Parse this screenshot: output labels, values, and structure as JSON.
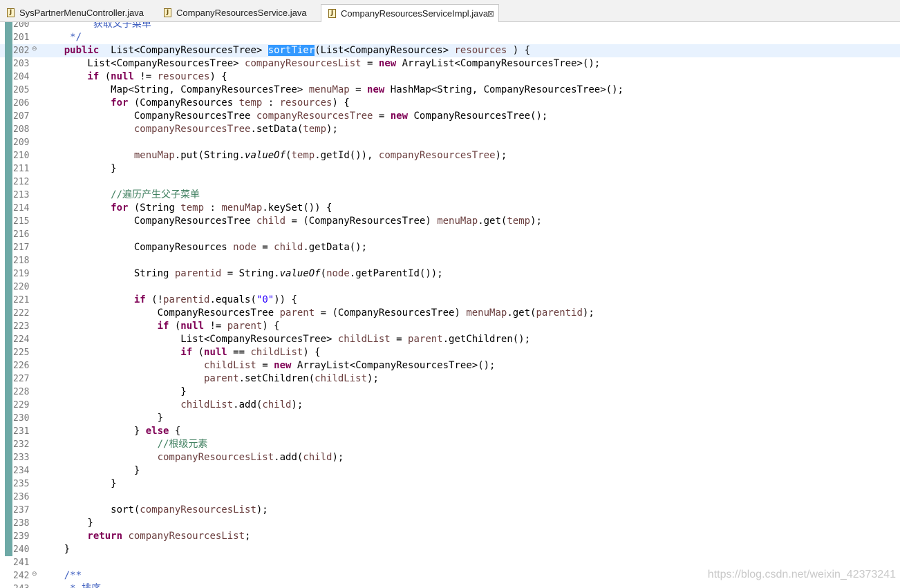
{
  "tabs": [
    {
      "label": "SysPartnerMenuController.java",
      "active": false
    },
    {
      "label": "CompanyResourcesService.java",
      "active": false
    },
    {
      "label": "CompanyResourcesServiceImpl.java",
      "active": true,
      "close": "⊠"
    }
  ],
  "editor": {
    "selected_token": "sortTier",
    "colors": {
      "keyword": "#7f0055",
      "field": "#6a3e3e",
      "comment": "#3f7f5f",
      "javadoc": "#3f5fbf",
      "string": "#2a00ff",
      "selection": "#3399ff"
    },
    "lines": [
      {
        "n": "200",
        "tokens": [
          [
            "jd",
            "         获取父子菜单"
          ]
        ],
        "bar": true
      },
      {
        "n": "201",
        "tokens": [
          [
            "jd",
            "     */"
          ]
        ],
        "bar": true
      },
      {
        "n": "202",
        "fold": true,
        "cur": true,
        "bar": true,
        "tokens": [
          [
            "kw",
            "    public"
          ],
          [
            "",
            "  List<CompanyResourcesTree> "
          ],
          [
            "hl",
            "sortTier"
          ],
          [
            "",
            "(List<CompanyResources> "
          ],
          [
            "fld",
            "resources"
          ],
          [
            "",
            " ) {"
          ]
        ]
      },
      {
        "n": "203",
        "bar": true,
        "tokens": [
          [
            "",
            "        List<CompanyResourcesTree> "
          ],
          [
            "fld",
            "companyResourcesList"
          ],
          [
            "",
            " = "
          ],
          [
            "kw",
            "new"
          ],
          [
            "",
            " ArrayList<CompanyResourcesTree>();"
          ]
        ]
      },
      {
        "n": "204",
        "bar": true,
        "tokens": [
          [
            "kw",
            "        if"
          ],
          [
            "",
            " ("
          ],
          [
            "kw",
            "null"
          ],
          [
            "",
            " != "
          ],
          [
            "fld",
            "resources"
          ],
          [
            "",
            ") {"
          ]
        ]
      },
      {
        "n": "205",
        "bar": true,
        "tokens": [
          [
            "",
            "            Map<String, CompanyResourcesTree> "
          ],
          [
            "fld",
            "menuMap"
          ],
          [
            "",
            " = "
          ],
          [
            "kw",
            "new"
          ],
          [
            "",
            " HashMap<String, CompanyResourcesTree>();"
          ]
        ]
      },
      {
        "n": "206",
        "bar": true,
        "tokens": [
          [
            "kw",
            "            for"
          ],
          [
            "",
            " (CompanyResources "
          ],
          [
            "fld",
            "temp"
          ],
          [
            "",
            " : "
          ],
          [
            "fld",
            "resources"
          ],
          [
            "",
            ") {"
          ]
        ]
      },
      {
        "n": "207",
        "bar": true,
        "tokens": [
          [
            "",
            "                CompanyResourcesTree "
          ],
          [
            "fld",
            "companyResourcesTree"
          ],
          [
            "",
            " = "
          ],
          [
            "kw",
            "new"
          ],
          [
            "",
            " CompanyResourcesTree();"
          ]
        ]
      },
      {
        "n": "208",
        "bar": true,
        "tokens": [
          [
            "fld",
            "                companyResourcesTree"
          ],
          [
            "",
            ".setData("
          ],
          [
            "fld",
            "temp"
          ],
          [
            "",
            ");"
          ]
        ]
      },
      {
        "n": "209",
        "bar": true,
        "tokens": []
      },
      {
        "n": "210",
        "bar": true,
        "tokens": [
          [
            "fld",
            "                menuMap"
          ],
          [
            "",
            ".put(String."
          ],
          [
            "it",
            "valueOf"
          ],
          [
            "",
            "("
          ],
          [
            "fld",
            "temp"
          ],
          [
            "",
            ".getId()), "
          ],
          [
            "fld",
            "companyResourcesTree"
          ],
          [
            "",
            ");"
          ]
        ]
      },
      {
        "n": "211",
        "bar": true,
        "tokens": [
          [
            "",
            "            }"
          ]
        ]
      },
      {
        "n": "212",
        "bar": true,
        "tokens": []
      },
      {
        "n": "213",
        "bar": true,
        "tokens": [
          [
            "cm",
            "            //遍历产生父子菜单"
          ]
        ]
      },
      {
        "n": "214",
        "bar": true,
        "tokens": [
          [
            "kw",
            "            for"
          ],
          [
            "",
            " (String "
          ],
          [
            "fld",
            "temp"
          ],
          [
            "",
            " : "
          ],
          [
            "fld",
            "menuMap"
          ],
          [
            "",
            ".keySet()) {"
          ]
        ]
      },
      {
        "n": "215",
        "bar": true,
        "tokens": [
          [
            "",
            "                CompanyResourcesTree "
          ],
          [
            "fld",
            "child"
          ],
          [
            "",
            " = (CompanyResourcesTree) "
          ],
          [
            "fld",
            "menuMap"
          ],
          [
            "",
            ".get("
          ],
          [
            "fld",
            "temp"
          ],
          [
            "",
            ");"
          ]
        ]
      },
      {
        "n": "216",
        "bar": true,
        "tokens": []
      },
      {
        "n": "217",
        "bar": true,
        "tokens": [
          [
            "",
            "                CompanyResources "
          ],
          [
            "fld",
            "node"
          ],
          [
            "",
            " = "
          ],
          [
            "fld",
            "child"
          ],
          [
            "",
            ".getData();"
          ]
        ]
      },
      {
        "n": "218",
        "bar": true,
        "tokens": []
      },
      {
        "n": "219",
        "bar": true,
        "tokens": [
          [
            "",
            "                String "
          ],
          [
            "fld",
            "parentid"
          ],
          [
            "",
            " = String."
          ],
          [
            "it",
            "valueOf"
          ],
          [
            "",
            "("
          ],
          [
            "fld",
            "node"
          ],
          [
            "",
            ".getParentId());"
          ]
        ]
      },
      {
        "n": "220",
        "bar": true,
        "tokens": []
      },
      {
        "n": "221",
        "bar": true,
        "tokens": [
          [
            "kw",
            "                if"
          ],
          [
            "",
            " (!"
          ],
          [
            "fld",
            "parentid"
          ],
          [
            "",
            ".equals("
          ],
          [
            "str",
            "\"0\""
          ],
          [
            "",
            ")) {"
          ]
        ]
      },
      {
        "n": "222",
        "bar": true,
        "tokens": [
          [
            "",
            "                    CompanyResourcesTree "
          ],
          [
            "fld",
            "parent"
          ],
          [
            "",
            " = (CompanyResourcesTree) "
          ],
          [
            "fld",
            "menuMap"
          ],
          [
            "",
            ".get("
          ],
          [
            "fld",
            "parentid"
          ],
          [
            "",
            ");"
          ]
        ]
      },
      {
        "n": "223",
        "bar": true,
        "tokens": [
          [
            "kw",
            "                    if"
          ],
          [
            "",
            " ("
          ],
          [
            "kw",
            "null"
          ],
          [
            "",
            " != "
          ],
          [
            "fld",
            "parent"
          ],
          [
            "",
            ") {"
          ]
        ]
      },
      {
        "n": "224",
        "bar": true,
        "tokens": [
          [
            "",
            "                        List<CompanyResourcesTree> "
          ],
          [
            "fld",
            "childList"
          ],
          [
            "",
            " = "
          ],
          [
            "fld",
            "parent"
          ],
          [
            "",
            ".getChildren();"
          ]
        ]
      },
      {
        "n": "225",
        "bar": true,
        "tokens": [
          [
            "kw",
            "                        if"
          ],
          [
            "",
            " ("
          ],
          [
            "kw",
            "null"
          ],
          [
            "",
            " == "
          ],
          [
            "fld",
            "childList"
          ],
          [
            "",
            ") {"
          ]
        ]
      },
      {
        "n": "226",
        "bar": true,
        "tokens": [
          [
            "fld",
            "                            childList"
          ],
          [
            "",
            " = "
          ],
          [
            "kw",
            "new"
          ],
          [
            "",
            " ArrayList<CompanyResourcesTree>();"
          ]
        ]
      },
      {
        "n": "227",
        "bar": true,
        "tokens": [
          [
            "fld",
            "                            parent"
          ],
          [
            "",
            ".setChildren("
          ],
          [
            "fld",
            "childList"
          ],
          [
            "",
            ");"
          ]
        ]
      },
      {
        "n": "228",
        "bar": true,
        "tokens": [
          [
            "",
            "                        }"
          ]
        ]
      },
      {
        "n": "229",
        "bar": true,
        "tokens": [
          [
            "fld",
            "                        childList"
          ],
          [
            "",
            ".add("
          ],
          [
            "fld",
            "child"
          ],
          [
            "",
            ");"
          ]
        ]
      },
      {
        "n": "230",
        "bar": true,
        "tokens": [
          [
            "",
            "                    }"
          ]
        ]
      },
      {
        "n": "231",
        "bar": true,
        "tokens": [
          [
            "",
            "                } "
          ],
          [
            "kw",
            "else"
          ],
          [
            "",
            " {"
          ]
        ]
      },
      {
        "n": "232",
        "bar": true,
        "tokens": [
          [
            "cm",
            "                    //根级元素"
          ]
        ]
      },
      {
        "n": "233",
        "bar": true,
        "tokens": [
          [
            "fld",
            "                    companyResourcesList"
          ],
          [
            "",
            ".add("
          ],
          [
            "fld",
            "child"
          ],
          [
            "",
            ");"
          ]
        ]
      },
      {
        "n": "234",
        "bar": true,
        "tokens": [
          [
            "",
            "                }"
          ]
        ]
      },
      {
        "n": "235",
        "bar": true,
        "tokens": [
          [
            "",
            "            }"
          ]
        ]
      },
      {
        "n": "236",
        "bar": true,
        "tokens": []
      },
      {
        "n": "237",
        "bar": true,
        "tokens": [
          [
            "",
            "            sort("
          ],
          [
            "fld",
            "companyResourcesList"
          ],
          [
            "",
            ");"
          ]
        ]
      },
      {
        "n": "238",
        "bar": true,
        "tokens": [
          [
            "",
            "        }"
          ]
        ]
      },
      {
        "n": "239",
        "bar": true,
        "tokens": [
          [
            "kw",
            "        return"
          ],
          [
            "",
            " "
          ],
          [
            "fld",
            "companyResourcesList"
          ],
          [
            "",
            ";"
          ]
        ]
      },
      {
        "n": "240",
        "bar": true,
        "tokens": [
          [
            "",
            "    }"
          ]
        ]
      },
      {
        "n": "241",
        "bar": false,
        "tokens": []
      },
      {
        "n": "242",
        "fold": true,
        "bar": false,
        "tokens": [
          [
            "jd",
            "    /**"
          ]
        ]
      },
      {
        "n": "243",
        "bar": false,
        "tokens": [
          [
            "jd",
            "     * 排序"
          ]
        ]
      }
    ]
  },
  "watermark": "https://blog.csdn.net/weixin_42373241"
}
